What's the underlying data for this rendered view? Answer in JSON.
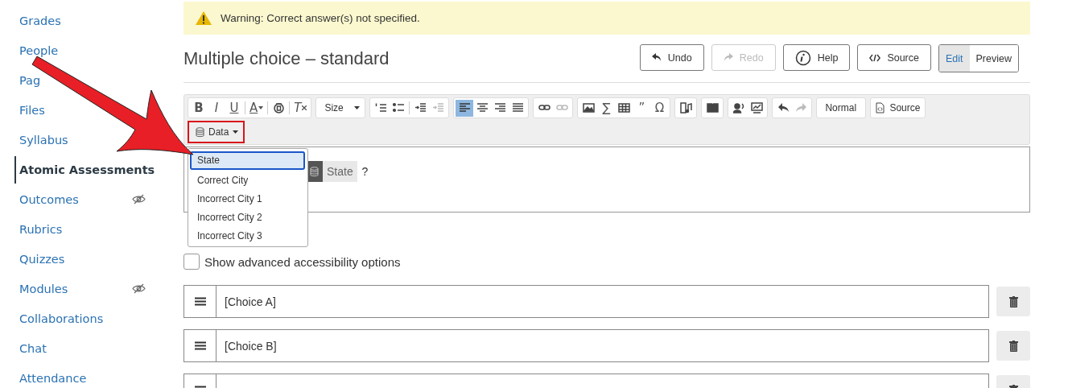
{
  "sidebar": {
    "items": [
      {
        "label": "Grades",
        "selected": false,
        "hidden": false
      },
      {
        "label": "People",
        "selected": false,
        "hidden": false
      },
      {
        "label": "Pag",
        "selected": false,
        "hidden": false
      },
      {
        "label": "Files",
        "selected": false,
        "hidden": false
      },
      {
        "label": "Syllabus",
        "selected": false,
        "hidden": false
      },
      {
        "label": "Atomic Assessments",
        "selected": true,
        "hidden": false
      },
      {
        "label": "Outcomes",
        "selected": false,
        "hidden": true
      },
      {
        "label": "Rubrics",
        "selected": false,
        "hidden": false
      },
      {
        "label": "Quizzes",
        "selected": false,
        "hidden": false
      },
      {
        "label": "Modules",
        "selected": false,
        "hidden": true
      },
      {
        "label": "Collaborations",
        "selected": false,
        "hidden": false
      },
      {
        "label": "Chat",
        "selected": false,
        "hidden": false
      },
      {
        "label": "Attendance",
        "selected": false,
        "hidden": false
      }
    ]
  },
  "warning": {
    "text": "Warning: Correct answer(s) not specified."
  },
  "title": "Multiple choice – standard",
  "header_buttons": [
    {
      "kind": "undo",
      "label": "Undo",
      "disabled": false
    },
    {
      "kind": "redo",
      "label": "Redo",
      "disabled": true
    },
    {
      "kind": "help",
      "label": "Help",
      "disabled": false
    },
    {
      "kind": "source",
      "label": "Source",
      "disabled": false
    }
  ],
  "view_toggle": [
    {
      "label": "Edit",
      "selected": true
    },
    {
      "label": "Preview",
      "selected": false
    }
  ],
  "toolbar": {
    "groups": [
      [
        {
          "kind": "bold",
          "label": "B",
          "disabled": false,
          "selected": false
        },
        {
          "kind": "italic",
          "label": "I",
          "disabled": false,
          "selected": false
        },
        {
          "kind": "underline",
          "label": "U",
          "disabled": false,
          "selected": false
        },
        {
          "kind": "sep"
        },
        {
          "kind": "text-color",
          "label": "A",
          "disabled": false,
          "selected": false
        },
        {
          "kind": "sep"
        },
        {
          "kind": "circle-mark",
          "disabled": false,
          "selected": false
        },
        {
          "kind": "sep"
        },
        {
          "kind": "clear-format",
          "label": "T",
          "disabled": false,
          "selected": false
        }
      ],
      [
        {
          "kind": "dropdown",
          "label": "Size"
        }
      ],
      [
        {
          "kind": "numbered-list",
          "disabled": false,
          "selected": false
        },
        {
          "kind": "bulleted-list",
          "disabled": false,
          "selected": false
        },
        {
          "kind": "sep"
        },
        {
          "kind": "indent",
          "disabled": false,
          "selected": false
        },
        {
          "kind": "outdent",
          "disabled": true,
          "selected": false
        }
      ],
      [
        {
          "kind": "align-left",
          "disabled": false,
          "selected": true
        },
        {
          "kind": "align-center",
          "disabled": false,
          "selected": false
        },
        {
          "kind": "align-right",
          "disabled": false,
          "selected": false
        },
        {
          "kind": "justify",
          "disabled": false,
          "selected": false
        }
      ],
      [
        {
          "kind": "link",
          "disabled": false,
          "selected": false
        },
        {
          "kind": "unlink",
          "disabled": true,
          "selected": false
        }
      ],
      [
        {
          "kind": "image",
          "disabled": false,
          "selected": false
        },
        {
          "kind": "glyph",
          "label": "∑",
          "disabled": false,
          "selected": false
        },
        {
          "kind": "table",
          "disabled": false,
          "selected": false
        },
        {
          "kind": "glyph",
          "label": "”",
          "disabled": false,
          "selected": false
        },
        {
          "kind": "glyph",
          "label": "Ω",
          "disabled": false,
          "selected": false
        }
      ],
      [
        {
          "kind": "audio",
          "disabled": false,
          "selected": false
        }
      ],
      [
        {
          "kind": "book",
          "disabled": false,
          "selected": false
        }
      ],
      [
        {
          "kind": "speaker",
          "disabled": false,
          "selected": false
        },
        {
          "kind": "monitor",
          "disabled": false,
          "selected": false
        }
      ],
      [
        {
          "kind": "undo",
          "disabled": false,
          "selected": false
        },
        {
          "kind": "redo",
          "disabled": true,
          "selected": false
        }
      ],
      [
        {
          "kind": "dropdown",
          "label": "Normal"
        }
      ],
      [
        {
          "kind": "source",
          "label": "Source"
        }
      ]
    ],
    "data_button": {
      "label": "Data",
      "highlighted": true
    }
  },
  "editor": {
    "token": "State",
    "after": "?"
  },
  "data_menu": [
    {
      "label": "State",
      "selected": true
    },
    {
      "label": "Correct City",
      "selected": false
    },
    {
      "label": "Incorrect City 1",
      "selected": false
    },
    {
      "label": "Incorrect City 2",
      "selected": false
    },
    {
      "label": "Incorrect City 3",
      "selected": false
    }
  ],
  "accessibility": {
    "label": "Show advanced accessibility options",
    "checked": false
  },
  "choices": [
    {
      "value": "[Choice A]"
    },
    {
      "value": "[Choice B]"
    },
    {
      "kind": "cut"
    }
  ]
}
